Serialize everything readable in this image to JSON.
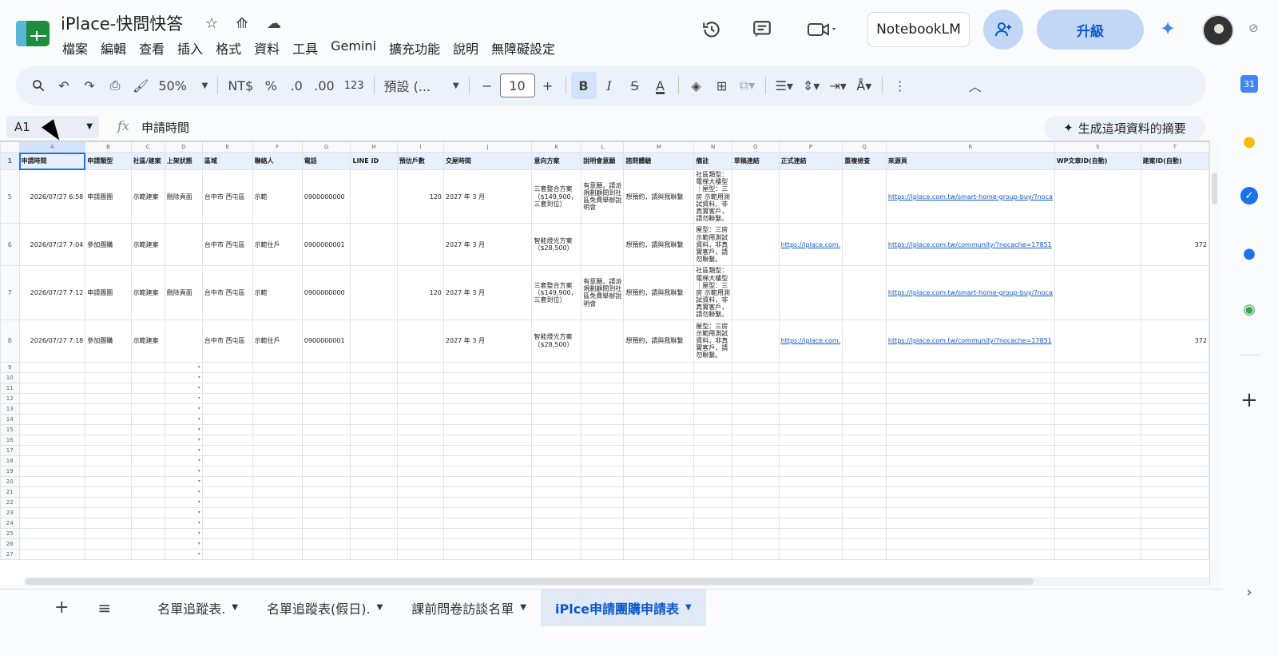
{
  "app": {
    "title": "iPlace-快問快答"
  },
  "menu": [
    "檔案",
    "編輯",
    "查看",
    "插入",
    "格式",
    "資料",
    "工具",
    "Gemini",
    "擴充功能",
    "說明",
    "無障礙設定"
  ],
  "header": {
    "notebook": "NotebookLM",
    "upgrade": "升級"
  },
  "toolbar": {
    "zoom": "50%",
    "currency": "NT$",
    "percent": "%",
    "dec_dec": ".0",
    "dec_inc": ".00",
    "num_format": "123",
    "font": "預設 (...",
    "font_size": "10",
    "minus": "−",
    "plus": "+",
    "bold": "B",
    "italic": "I",
    "strike": "S",
    "color_a": "A"
  },
  "formula": {
    "cell": "A1",
    "fx": "fx",
    "value": "申請時間",
    "summary": "生成這項資料的摘要"
  },
  "columns": [
    "A",
    "B",
    "C",
    "D",
    "E",
    "F",
    "G",
    "H",
    "I",
    "J",
    "K",
    "L",
    "M",
    "N",
    "O",
    "P",
    "Q",
    "R",
    "S",
    "T"
  ],
  "header_row": {
    "num": "1",
    "cells": [
      "申請時間",
      "申請類型",
      "社區/建案",
      "上架狀態",
      "區域",
      "聯絡人",
      "電話",
      "LINE ID",
      "預估戶數",
      "交屋時間",
      "意向方案",
      "說明會意願",
      "諮問體驗",
      "備註",
      "草稿連結",
      "正式連結",
      "重複檢查",
      "來源頁",
      "WP文章ID(自動)",
      "建案ID(自動)"
    ]
  },
  "rows": [
    {
      "num": "5",
      "cells": [
        "2026/07/27 6:58",
        "申請團團",
        "示範建案",
        "刪除頁面",
        "台中市 西屯區",
        "示範",
        "0900000000",
        "",
        "120",
        "2027 年 3 月",
        "三套整合方案（$149,900，三套到位）",
        "有意願，請派規劃顧問到社區免費舉辦說明會",
        "想預約，請與我聯繫",
        "社區類型：電梯大樓型｜屋型：三房 示範用測試資料，非真實客戶，請勿聯繫。",
        "",
        "",
        "",
        "https://iplace.com.tw/smart-home-group-buy/?noca",
        "",
        ""
      ]
    },
    {
      "num": "6",
      "cells": [
        "2026/07/27 7:04",
        "參加團購",
        "示範建案",
        "",
        "台中市 西屯區",
        "示範住戶",
        "0900000001",
        "",
        "",
        "2027 年 3 月",
        "智能燈光方案（$28,500）",
        "",
        "想預約，請與我聯繫",
        "屋型：三房 示範用測試資料，非真實客戶，請勿聯繫。",
        "",
        "https://iplace.com.",
        "",
        "https://iplace.com.tw/community/?nocache=17851",
        "",
        "372"
      ]
    },
    {
      "num": "7",
      "cells": [
        "2026/07/27 7:12",
        "申請團團",
        "示範建案",
        "刪除頁面",
        "台中市 西屯區",
        "示範",
        "0900000000",
        "",
        "120",
        "2027 年 3 月",
        "三套整合方案（$149,900，三套到位）",
        "有意願，請派規劃顧問到社區免費舉辦說明會",
        "想預約，請與我聯繫",
        "社區類型：電梯大樓型｜屋型：三房 示範用測試資料，非真實客戶，請勿聯繫。",
        "",
        "",
        "",
        "https://iplace.com.tw/smart-home-group-buy/?noca",
        "",
        ""
      ]
    },
    {
      "num": "8",
      "cells": [
        "2026/07/27 7:18",
        "參加團購",
        "示範建案",
        "",
        "台中市 西屯區",
        "示範住戶",
        "0900000001",
        "",
        "",
        "2027 年 3 月",
        "智能燈光方案（$28,500）",
        "",
        "想預約，請與我聯繫",
        "屋型：三房 示範用測試資料，非真實客戶，請勿聯繫。",
        "",
        "https://iplace.com.",
        "",
        "https://iplace.com.tw/community/?nocache=17851",
        "",
        "372"
      ]
    }
  ],
  "empty_rows": [
    "9",
    "10",
    "11",
    "12",
    "13",
    "14",
    "15",
    "16",
    "17",
    "18",
    "19",
    "20",
    "21",
    "22",
    "23",
    "24",
    "25",
    "26",
    "27"
  ],
  "tabs": [
    "名單追蹤表.",
    "名單追蹤表(假日).",
    "課前問卷訪談名單",
    "iPlce申請團購申請表"
  ],
  "sidebar": {
    "calendar": "31"
  }
}
